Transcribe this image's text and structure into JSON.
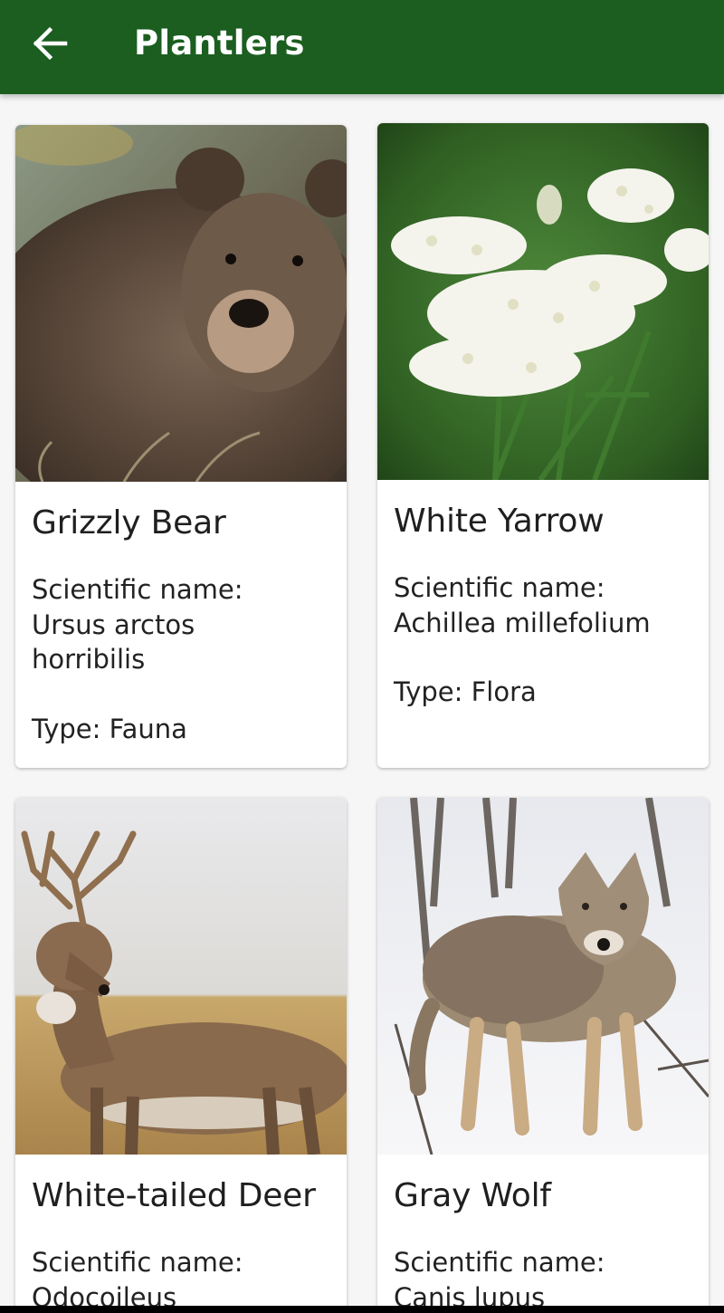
{
  "app_bar": {
    "title": "Plantlers",
    "back_icon": "arrow-left-icon"
  },
  "colors": {
    "app_bar": "#1b5e20",
    "background": "#f6f6f6",
    "card": "#ffffff"
  },
  "cards": [
    {
      "title": "Grizzly Bear",
      "sci_label": "Scientific name:",
      "sci_lines": [
        "Ursus arctos",
        "horribilis"
      ],
      "type": "Type: Fauna",
      "image": "grizzly-bear-photo"
    },
    {
      "title": "White Yarrow",
      "sci_label": "Scientific name:",
      "sci_lines": [
        "Achillea millefolium"
      ],
      "type": "Type: Flora",
      "image": "white-yarrow-photo"
    },
    {
      "title": "White-tailed Deer",
      "sci_label": "Scientific name:",
      "sci_lines": [
        "Odocoileus"
      ],
      "image": "white-tailed-deer-photo"
    },
    {
      "title": "Gray Wolf",
      "sci_label": "Scientific name:",
      "sci_lines": [
        "Canis lupus"
      ],
      "image": "gray-wolf-photo"
    }
  ]
}
